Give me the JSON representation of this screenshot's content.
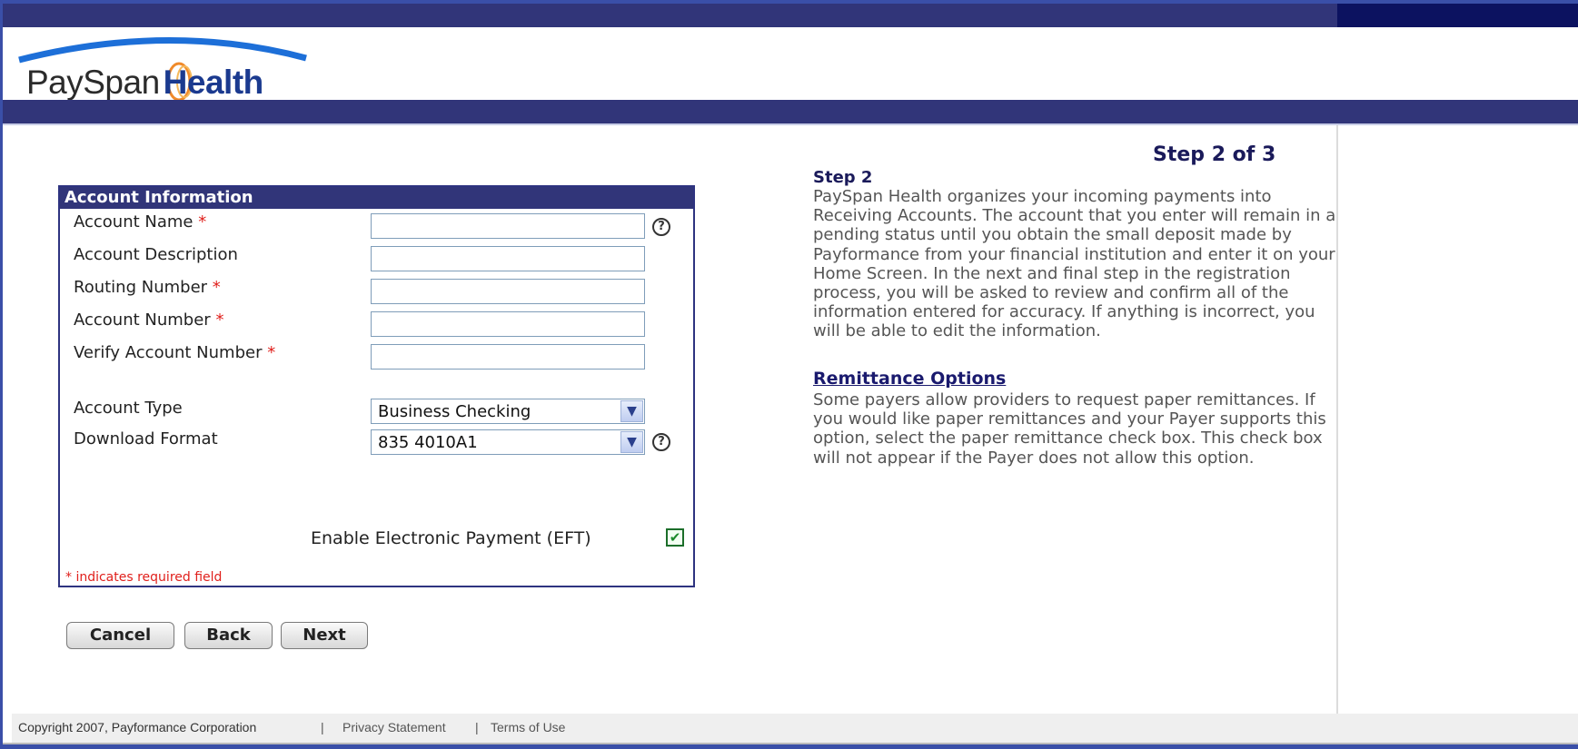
{
  "brand": {
    "pay": "PaySpan",
    "health": "Health"
  },
  "step": {
    "label": "Step 2 of 3"
  },
  "form": {
    "title": "Account Information",
    "fields": [
      {
        "label": "Account Name",
        "required": "*",
        "value": ""
      },
      {
        "label": "Account Description",
        "required": "",
        "value": ""
      },
      {
        "label": "Routing Number",
        "required": "*",
        "value": ""
      },
      {
        "label": "Account Number",
        "required": "*",
        "value": ""
      },
      {
        "label": "Verify Account Number",
        "required": "*",
        "value": ""
      }
    ],
    "account_type": {
      "label": "Account Type",
      "value": "Business Checking"
    },
    "download_format": {
      "label": "Download Format",
      "value": "835 4010A1"
    },
    "eft": {
      "label": "Enable Electronic Payment (EFT)",
      "checked": true
    },
    "required_note": "* indicates required field",
    "help_icon": "?"
  },
  "buttons": {
    "cancel": "Cancel",
    "back": "Back",
    "next": "Next"
  },
  "help": {
    "step_title": "Step 2",
    "step_text": "PaySpan Health organizes your incoming payments into Receiving Accounts. The account that you enter will remain in a pending status until you obtain the small deposit made by Payformance from your financial institution and enter it on your Home Screen. In the next and final step in the registration process, you will be asked to review and confirm all of the information entered for accuracy. If anything is incorrect, you will be able to edit the information.",
    "remittance_title": "Remittance Options",
    "remittance_text": "Some payers allow providers to request paper remittances. If you would like paper remittances and your Payer supports this option, select the paper remittance check box. This check box will not appear if the Payer does not allow this option."
  },
  "footer": {
    "copyright": "Copyright 2007, Payformance Corporation",
    "sep": "|",
    "privacy": "Privacy Statement",
    "terms": "Terms of Use"
  },
  "colors": {
    "header_bar": "#313579",
    "header_dark": "#0c1260",
    "required": "#e0201c",
    "title_text": "#1a1a5a"
  },
  "icons": {
    "help": "question-circle-icon",
    "dropdown": "chevron-down-icon",
    "check": "checkmark-icon"
  }
}
